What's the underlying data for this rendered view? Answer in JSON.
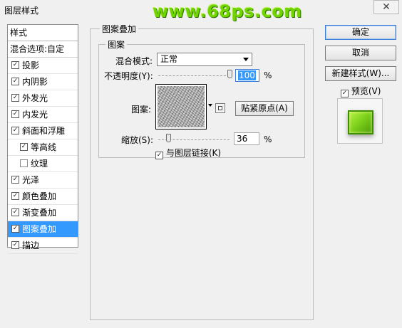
{
  "window": {
    "title": "图层样式",
    "watermark": "www.68ps.com",
    "close_glyph": "✕"
  },
  "style_list": {
    "header": "样式",
    "blend_options": "混合选项:自定",
    "items": [
      {
        "label": "投影",
        "checked": true
      },
      {
        "label": "内阴影",
        "checked": true
      },
      {
        "label": "外发光",
        "checked": true
      },
      {
        "label": "内发光",
        "checked": true
      },
      {
        "label": "斜面和浮雕",
        "checked": true
      },
      {
        "label": "等高线",
        "checked": true,
        "sub": true
      },
      {
        "label": "纹理",
        "checked": false,
        "sub": true
      },
      {
        "label": "光泽",
        "checked": true
      },
      {
        "label": "颜色叠加",
        "checked": true
      },
      {
        "label": "渐变叠加",
        "checked": true
      },
      {
        "label": "图案叠加",
        "checked": true,
        "selected": true
      },
      {
        "label": "描边",
        "checked": true
      }
    ],
    "check_glyph": "✓",
    "selected_color": "#3399ff"
  },
  "panel": {
    "section_title": "图案叠加",
    "group_title": "图案",
    "blend_mode_label": "混合模式:",
    "blend_mode_value": "正常",
    "opacity_label": "不透明度(Y):",
    "opacity_value": "100",
    "opacity_percent": 100,
    "opacity_unit": "%",
    "pattern_label": "图案:",
    "snap_origin_button": "贴紧原点(A)",
    "scale_label": "缩放(S):",
    "scale_value": "36",
    "scale_percent": 36,
    "scale_unit": "%",
    "link_layer_label": "与图层链接(K)",
    "link_layer_checked": true
  },
  "buttons": {
    "ok": "确定",
    "cancel": "取消",
    "new_style": "新建样式(W)...",
    "preview_label": "预览(V)",
    "preview_checked": true
  },
  "colors": {
    "accent": "#3399ff",
    "preview_green": "#7fd31c",
    "watermark_green": "#6fd400"
  }
}
